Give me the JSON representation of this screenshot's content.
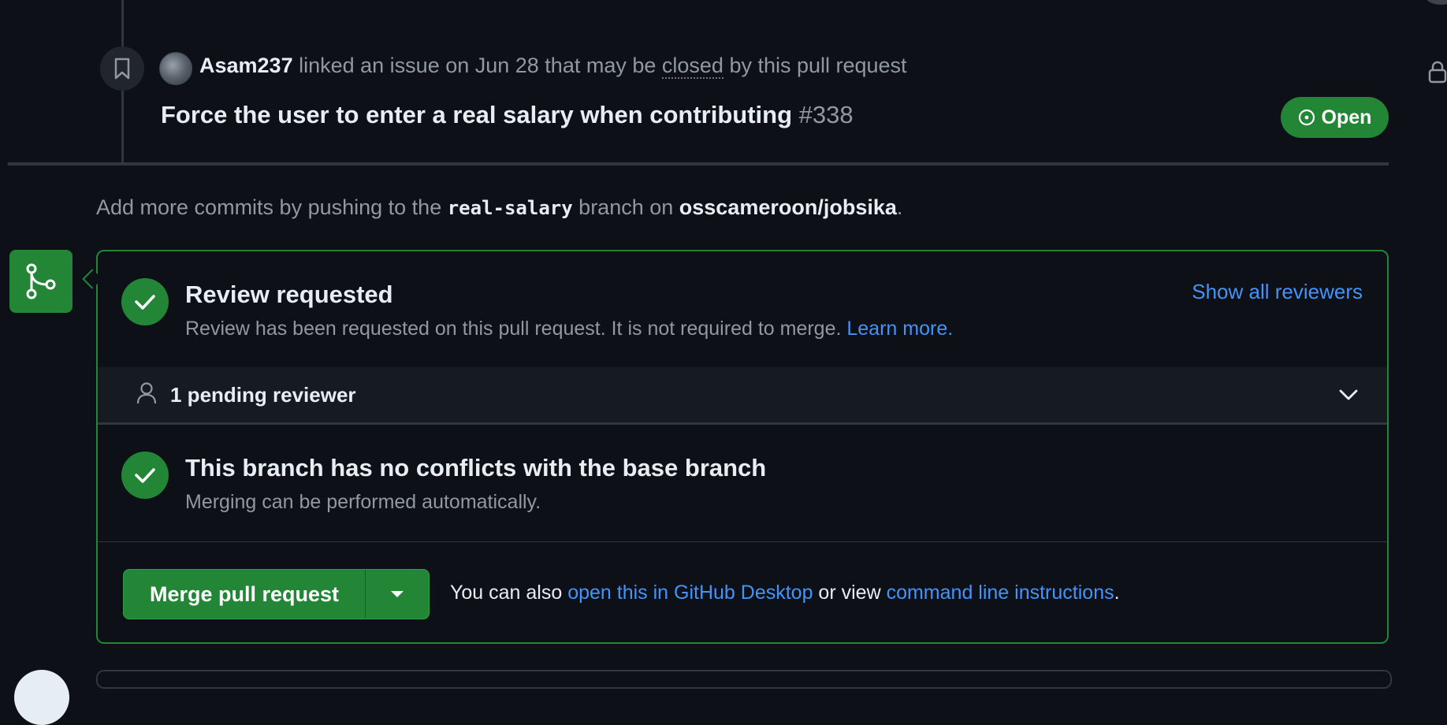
{
  "event": {
    "user": "Asam237",
    "text_before": " linked an issue on Jun 28 that may be ",
    "closed_word": "closed",
    "text_after": " by this pull request"
  },
  "issue": {
    "title": "Force the user to enter a real salary when contributing",
    "number": "#338",
    "status": "Open"
  },
  "commits": {
    "prefix": "Add more commits by pushing to the ",
    "branch": "real-salary",
    "middle": " branch on ",
    "repo": "osscameroon/jobsika",
    "suffix": "."
  },
  "review": {
    "title": "Review requested",
    "description": "Review has been requested on this pull request. It is not required to merge. ",
    "learn_more": "Learn more.",
    "show_all": "Show all reviewers",
    "pending": "1 pending reviewer"
  },
  "conflicts": {
    "title": "This branch has no conflicts with the base branch",
    "description": "Merging can be performed automatically."
  },
  "merge": {
    "button_label": "Merge pull request",
    "also_prefix": "You can also ",
    "desktop_link": "open this in GitHub Desktop",
    "or_view": " or view ",
    "cli_link": "command line instructions",
    "suffix": "."
  },
  "colors": {
    "accent_green": "#238636",
    "link_blue": "#4493f8",
    "background": "#0d1117"
  },
  "icons": [
    "bookmark-icon",
    "issue-open-icon",
    "git-merge-icon",
    "check-icon",
    "person-icon",
    "chevron-down-icon",
    "triangle-down-icon",
    "lock-icon"
  ]
}
